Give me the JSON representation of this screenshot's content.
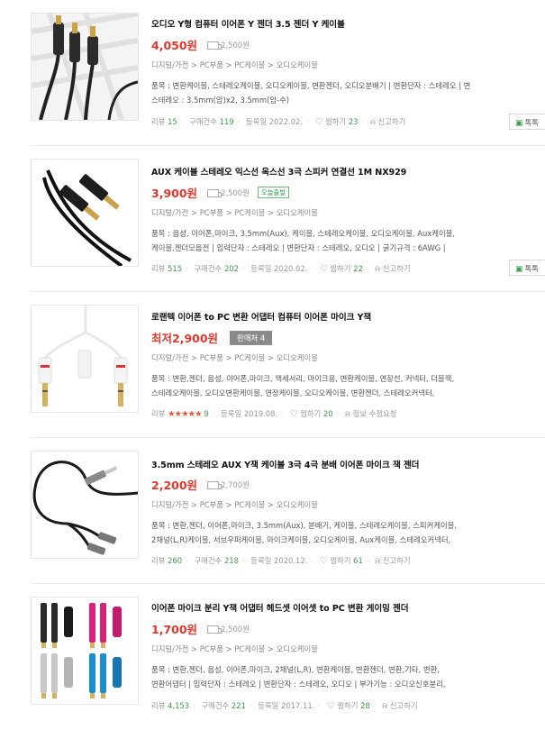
{
  "products": [
    {
      "title": "오디오 Y형 컴퓨터 이어폰 Y 젠더 3.5 젠더 Y 케이블",
      "price": "4,050원",
      "shipping": "2,500원",
      "badge": "",
      "seller_count": "",
      "category": "디지털/가전 > PC부품 > PC케이블 > 오디오케이블",
      "spec_lines": [
        "품목 : 변환케이블, 스테레오케이블, 오디오케이블, 변환젠더, 오디오분배기  |  변환단자 : 스테레오  |  변",
        "스테레오 : 3.5mm(암)x2, 3.5mm(암-수)"
      ],
      "rating_stars": "",
      "review_label": "리뷰",
      "review_count": "15",
      "purchase_label": "구매건수",
      "purchase_count": "119",
      "reg_date": "등록일 2022.02.",
      "wish_label": "찜하기",
      "wish_count": "23",
      "report_label": "신고하기",
      "extra_label": "",
      "talk_label": "톡톡",
      "icons": {
        "wish": "heart-icon",
        "report": "alarm-icon",
        "talk": "chat-icon",
        "ship": "truck-icon"
      }
    },
    {
      "title": "AUX 케이블 스테레오 익스선 옥스선 3극 스피커 연결선 1M NX929",
      "price": "3,900원",
      "shipping": "2,500원",
      "badge": "오늘출발",
      "seller_count": "",
      "category": "디지털/가전 > PC부품 > PC케이블 > 오디오케이블",
      "spec_lines": [
        "품목 : 음성, 이어폰,마이크, 3.5mm(Aux), 케이블, 스테레오케이블, 오디오케이블, Aux케이블,",
        "케이블,젠더모음전  |  입력단자 : 스테레오  |  변환단자 : 스테레오, 오디오  |  굵기규격 : 6AWG  |"
      ],
      "rating_stars": "",
      "review_label": "리뷰",
      "review_count": "515",
      "purchase_label": "구매건수",
      "purchase_count": "202",
      "reg_date": "등록일 2020.02.",
      "wish_label": "찜하기",
      "wish_count": "22",
      "report_label": "신고하기",
      "extra_label": "",
      "talk_label": "톡톡"
    },
    {
      "title": "로랜텍 이어폰 to PC 변환 어댑터 컴퓨터 이어폰 마이크 Y잭",
      "price": "최저2,900원",
      "shipping": "",
      "badge": "",
      "seller_count": "판매처 4",
      "category": "디지털/가전 > PC부품 > PC케이블 > 오디오케이블",
      "spec_lines": [
        "품목 : 변환,젠더, 음성, 이어폰,마이크, 액세서리, 마이크용, 변환케이블, 연장선, 커넥터, 더블잭,",
        "스테레오케이블, 오디오변환케이블, 연장케이블, 오디오케이블, 변환젠더, 스테레오커넥터,"
      ],
      "rating_stars": "★★★★★",
      "review_label": "리뷰",
      "review_count": "9",
      "purchase_label": "",
      "purchase_count": "",
      "reg_date": "등록일 2019.08.",
      "wish_label": "찜하기",
      "wish_count": "20",
      "report_label": "",
      "extra_label": "정보 수정요청",
      "talk_label": ""
    },
    {
      "title": "3.5mm 스테레오 AUX Y잭 케이블 3극 4극 분배 이어폰 마이크 잭 젠더",
      "price": "2,200원",
      "shipping": "2,700원",
      "badge": "",
      "seller_count": "",
      "category": "디지털/가전 > PC부품 > PC케이블 > 오디오케이블",
      "spec_lines": [
        "품목 : 변환,젠더, 이어폰,마이크, 3.5mm(Aux), 분배기, 케이블, 스테레오케이블, 스피커케이블,",
        "2채널(L,R)케이블, 서브우퍼케이블, 마이크케이블, 오디오케이블, Aux케이블, 스테레오커넥터,"
      ],
      "rating_stars": "",
      "review_label": "리뷰",
      "review_count": "260",
      "purchase_label": "구매건수",
      "purchase_count": "218",
      "reg_date": "등록일 2020.12.",
      "wish_label": "찜하기",
      "wish_count": "61",
      "report_label": "신고하기",
      "extra_label": "",
      "talk_label": ""
    },
    {
      "title": "이어폰 마이크 분리 Y잭 어댑터 헤드셋 이어셋 to PC 변환 게이밍 젠더",
      "price": "1,700원",
      "shipping": "2,500원",
      "badge": "",
      "seller_count": "",
      "category": "디지털/가전 > PC부품 > PC케이블 > 오디오케이블",
      "spec_lines": [
        "품목 : 변환,젠더, 음성, 이어폰,마이크, 2채널(L,R), 변환케이블, 변환젠더, 변환,기타, 변환,",
        "변환어댑터  |  입력단자 : 스테레오  |  변환단자 : 스테레오, 오디오  |  부가기능 : 오디오신호분리,"
      ],
      "rating_stars": "",
      "review_label": "리뷰",
      "review_count": "4,153",
      "purchase_label": "구매건수",
      "purchase_count": "221",
      "reg_date": "등록일 2017.11.",
      "wish_label": "찜하기",
      "wish_count": "28",
      "report_label": "신고하기",
      "extra_label": "",
      "talk_label": ""
    }
  ],
  "colors": {
    "price": "#e2372c",
    "count": "#3f9a49",
    "badge": "#2f9c4c",
    "star": "#e65a3b"
  }
}
